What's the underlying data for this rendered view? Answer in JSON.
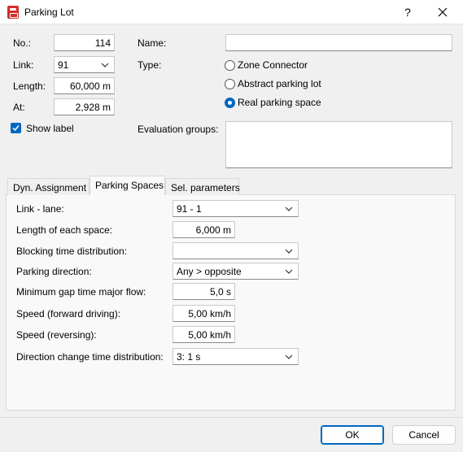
{
  "window": {
    "title": "Parking Lot",
    "help": "?"
  },
  "general": {
    "no_label": "No.:",
    "no_value": "114",
    "link_label": "Link:",
    "link_value": "91",
    "length_label": "Length:",
    "length_value": "60,000 m",
    "at_label": "At:",
    "at_value": "2,928 m",
    "show_label": "Show label",
    "name_label": "Name:",
    "name_value": "",
    "type_label": "Type:",
    "types": [
      "Zone Connector",
      "Abstract parking lot",
      "Real parking space"
    ],
    "selected_type": "Real parking space",
    "eval_groups_label": "Evaluation groups:"
  },
  "tabs": [
    "Dyn. Assignment",
    "Parking Spaces",
    "Sel. parameters"
  ],
  "active_tab": "Parking Spaces",
  "parking": {
    "link_lane_label": "Link - lane:",
    "link_lane_value": "91 - 1",
    "length_each_label": "Length of each space:",
    "length_each_value": "6,000 m",
    "blocking_label": "Blocking time distribution:",
    "blocking_value": "",
    "direction_label": "Parking direction:",
    "direction_value": "Any > opposite",
    "gap_label": "Minimum gap time major flow:",
    "gap_value": "5,0 s",
    "speed_fwd_label": "Speed (forward driving):",
    "speed_fwd_value": "5,00 km/h",
    "speed_rev_label": "Speed (reversing):",
    "speed_rev_value": "5,00 km/h",
    "dir_change_label": "Direction change time distribution:",
    "dir_change_value": "3: 1 s"
  },
  "buttons": {
    "ok": "OK",
    "cancel": "Cancel"
  },
  "colors": {
    "accent": "#0067c0",
    "app_icon": "#d0312d"
  }
}
